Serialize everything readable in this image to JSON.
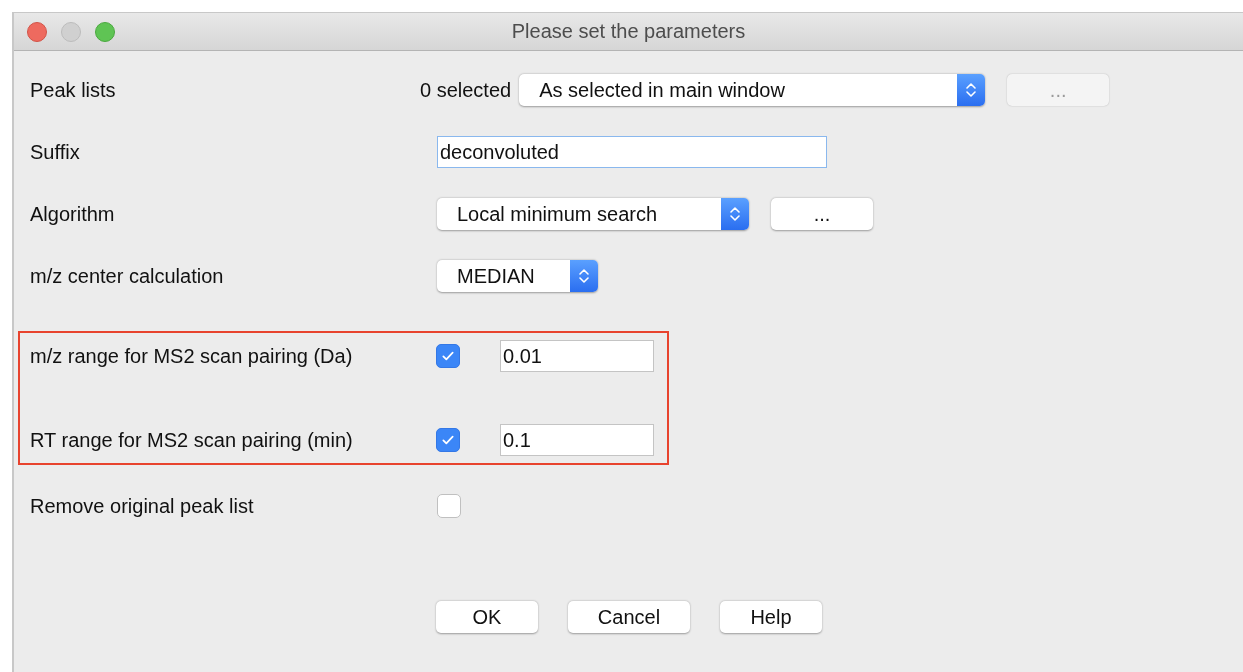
{
  "window": {
    "title": "Please set the parameters"
  },
  "sections": [
    {
      "highlighted": false,
      "parameters": [
        {
          "kind": "combo_count",
          "label": "Peak lists",
          "count": "0 selected",
          "value": "As selected in main window",
          "button": {
            "label": "...",
            "disabled": true
          }
        },
        {
          "kind": "text",
          "label": "Suffix",
          "value": "deconvoluted",
          "focused": true
        },
        {
          "kind": "combo_button",
          "label": "Algorithm",
          "value": "Local minimum search",
          "button": {
            "label": "...",
            "disabled": false
          }
        },
        {
          "kind": "combo",
          "label": "m/z center calculation",
          "value": "MEDIAN"
        }
      ]
    },
    {
      "highlighted": true,
      "parameters": [
        {
          "kind": "check_text",
          "label": "m/z range for MS2 scan pairing (Da)",
          "checked": true,
          "value": "0.01"
        },
        {
          "kind": "check_text",
          "label": "RT range for MS2 scan pairing (min)",
          "checked": true,
          "value": "0.1"
        }
      ]
    },
    {
      "highlighted": false,
      "parameters": [
        {
          "kind": "checkbox",
          "label": "Remove original peak list",
          "checked": false
        }
      ]
    }
  ],
  "buttons": [
    {
      "label": "OK"
    },
    {
      "label": "Cancel"
    },
    {
      "label": "Help"
    }
  ]
}
